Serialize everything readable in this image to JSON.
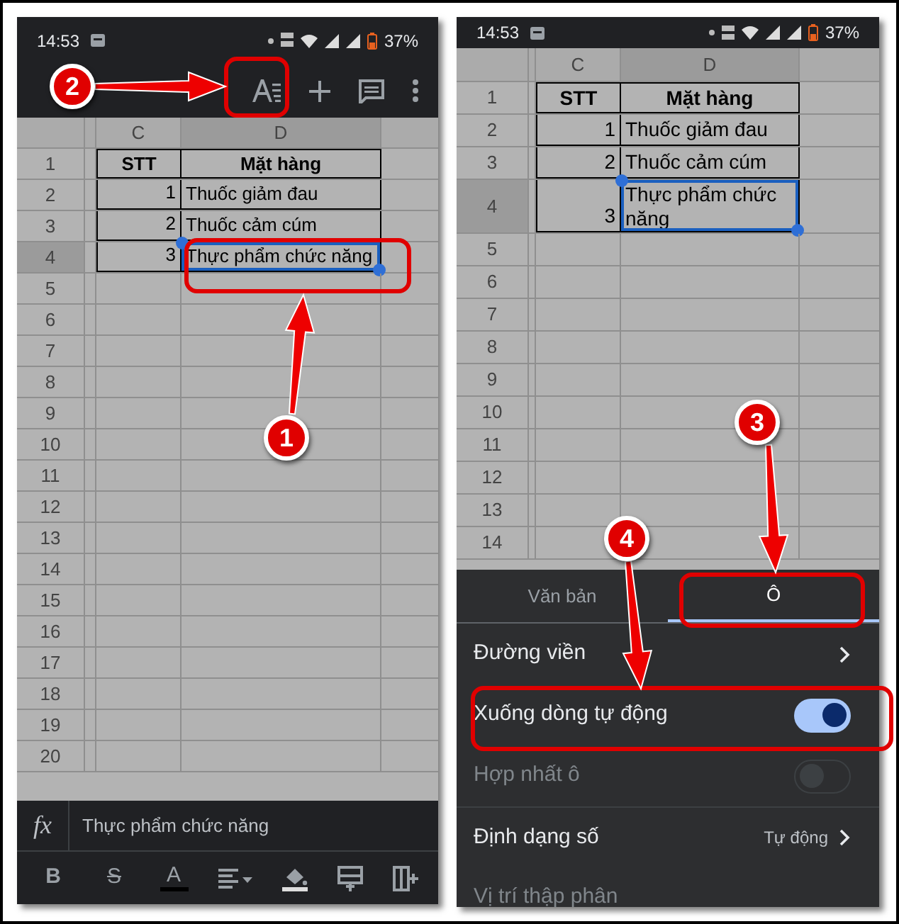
{
  "left_screen": {
    "status_bar": {
      "time": "14:53",
      "battery": "37%"
    },
    "grid": {
      "wrap_text": false,
      "columns": [
        {
          "label": "C",
          "selected": false
        },
        {
          "label": "D",
          "selected": true
        }
      ],
      "rows": [
        {
          "number": "1",
          "selected": false,
          "cells": [
            {
              "kind": "header",
              "text": "STT"
            },
            {
              "kind": "header",
              "text": "Mặt hàng"
            }
          ]
        },
        {
          "number": "2",
          "selected": false,
          "cells": [
            {
              "kind": "number",
              "text": "1"
            },
            {
              "kind": "text",
              "text": "Thuốc giảm đau"
            }
          ]
        },
        {
          "number": "3",
          "selected": false,
          "cells": [
            {
              "kind": "number",
              "text": "2"
            },
            {
              "kind": "text",
              "text": "Thuốc cảm cúm"
            }
          ]
        },
        {
          "number": "4",
          "selected": true,
          "cells": [
            {
              "kind": "number",
              "text": "3"
            },
            {
              "kind": "text",
              "text": "Thực phẩm chức năng"
            }
          ]
        },
        {
          "number": "5",
          "selected": false
        },
        {
          "number": "6",
          "selected": false
        },
        {
          "number": "7",
          "selected": false
        },
        {
          "number": "8",
          "selected": false
        },
        {
          "number": "9",
          "selected": false
        },
        {
          "number": "10",
          "selected": false
        },
        {
          "number": "11",
          "selected": false
        },
        {
          "number": "12",
          "selected": false
        },
        {
          "number": "13",
          "selected": false
        },
        {
          "number": "14",
          "selected": false
        },
        {
          "number": "15",
          "selected": false
        },
        {
          "number": "16",
          "selected": false
        },
        {
          "number": "17",
          "selected": false
        },
        {
          "number": "18",
          "selected": false
        },
        {
          "number": "19",
          "selected": false
        },
        {
          "number": "20",
          "selected": false
        }
      ]
    },
    "formula_bar": {
      "label": "fx",
      "value": "Thực phẩm chức năng"
    },
    "format_toolbar": [
      {
        "kind": "glyph",
        "glyph": "B"
      },
      {
        "kind": "strike",
        "glyph": "S"
      },
      {
        "kind": "color",
        "glyph": "A"
      },
      {
        "kind": "align"
      },
      {
        "kind": "fill"
      },
      {
        "kind": "row"
      },
      {
        "kind": "column"
      }
    ]
  },
  "right_screen": {
    "status_bar": {
      "time": "14:53",
      "battery": "37%"
    },
    "grid": {
      "wrap_text": true,
      "columns": [
        {
          "label": "C",
          "selected": false
        },
        {
          "label": "D",
          "selected": true
        }
      ],
      "rows": [
        {
          "number": "1",
          "selected": false,
          "cells": [
            {
              "kind": "header",
              "text": "STT"
            },
            {
              "kind": "header",
              "text": "Mặt hàng"
            }
          ]
        },
        {
          "number": "2",
          "selected": false,
          "cells": [
            {
              "kind": "number",
              "text": "1"
            },
            {
              "kind": "text",
              "text": "Thuốc giảm đau"
            }
          ]
        },
        {
          "number": "3",
          "selected": false,
          "cells": [
            {
              "kind": "number",
              "text": "2"
            },
            {
              "kind": "text",
              "text": "Thuốc cảm cúm"
            }
          ]
        },
        {
          "number": "4",
          "selected": true,
          "cells": [
            {
              "kind": "number",
              "text": "3"
            },
            {
              "kind": "text",
              "text": "Thực phẩm chức năng"
            }
          ]
        },
        {
          "number": "5",
          "selected": false
        },
        {
          "number": "6",
          "selected": false
        },
        {
          "number": "7",
          "selected": false
        },
        {
          "number": "8",
          "selected": false
        },
        {
          "number": "9",
          "selected": false
        },
        {
          "number": "10",
          "selected": false
        },
        {
          "number": "11",
          "selected": false
        },
        {
          "number": "12",
          "selected": false
        },
        {
          "number": "13",
          "selected": false
        },
        {
          "number": "14",
          "selected": false
        }
      ]
    },
    "sheet": {
      "tabs": [
        {
          "label": "Văn bản",
          "selected": false
        },
        {
          "label": "Ô",
          "selected": true
        }
      ],
      "settings": [
        {
          "kind": "link",
          "label": "Đường viền",
          "disabled": false
        },
        {
          "kind": "toggle",
          "label": "Xuống dòng tự động",
          "on": true,
          "disabled": false
        },
        {
          "kind": "toggle",
          "label": "Hợp nhất ô",
          "on": false,
          "disabled": true
        },
        {
          "kind": "value",
          "label": "Định dạng số",
          "value": "Tự động",
          "disabled": false
        },
        {
          "kind": "link",
          "label": "Vị trí thập phân",
          "disabled": true
        }
      ]
    }
  },
  "callouts": [
    {
      "number": "2"
    },
    {
      "number": "1"
    },
    {
      "number": "3"
    },
    {
      "number": "4"
    }
  ]
}
